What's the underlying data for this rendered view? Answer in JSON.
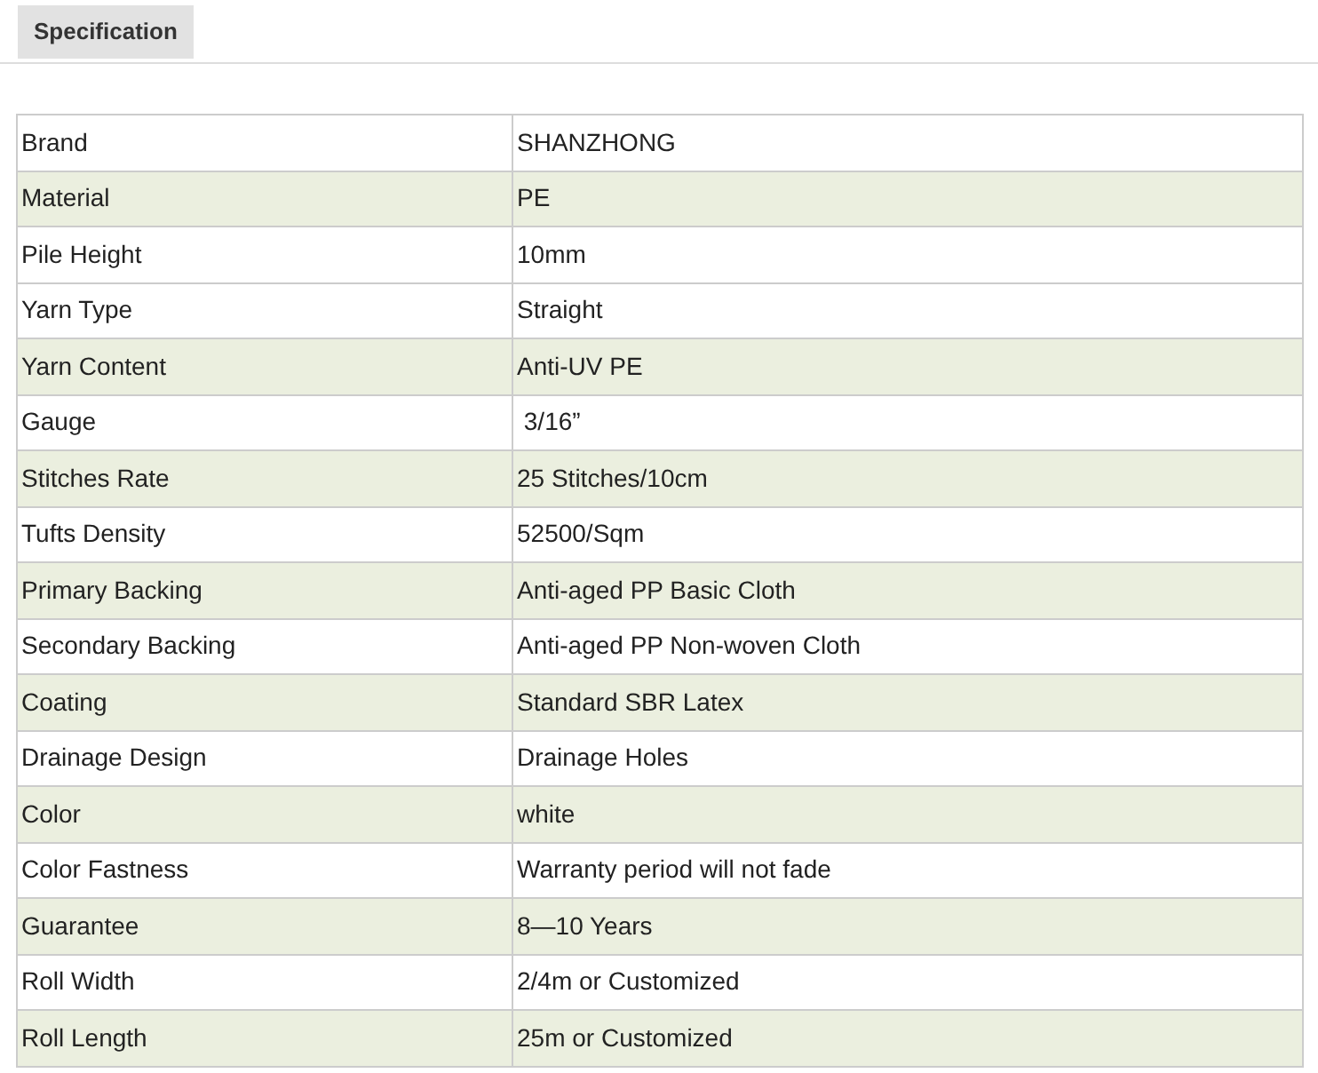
{
  "tabs": [
    {
      "label": "Specification",
      "selected": true
    }
  ],
  "table": {
    "rows": [
      {
        "label": "Brand",
        "value": "SHANZHONG",
        "shaded": false
      },
      {
        "label": "Material",
        "value": "PE",
        "shaded": true
      },
      {
        "label": "Pile Height",
        "value": "10mm",
        "shaded": false
      },
      {
        "label": "Yarn Type",
        "value": "Straight",
        "shaded": false
      },
      {
        "label": "Yarn Content",
        "value": "Anti-UV PE",
        "shaded": true
      },
      {
        "label": "Gauge",
        "value": " 3/16”",
        "shaded": false
      },
      {
        "label": "Stitches Rate",
        "value": "25 Stitches/10cm",
        "shaded": true
      },
      {
        "label": "Tufts Density",
        "value": "52500/Sqm",
        "shaded": false
      },
      {
        "label": "Primary Backing",
        "value": "Anti-aged PP Basic Cloth",
        "shaded": true
      },
      {
        "label": "Secondary Backing",
        "value": "Anti-aged PP Non-woven Cloth",
        "shaded": false
      },
      {
        "label": "Coating",
        "value": "Standard SBR Latex",
        "shaded": true
      },
      {
        "label": "Drainage Design",
        "value": "Drainage Holes",
        "shaded": false
      },
      {
        "label": "Color",
        "value": "white",
        "shaded": true
      },
      {
        "label": "Color Fastness",
        "value": "Warranty period will not fade",
        "shaded": false
      },
      {
        "label": "Guarantee",
        "value": "8—10 Years",
        "shaded": true
      },
      {
        "label": "Roll Width",
        "value": "2/4m or Customized",
        "shaded": false
      },
      {
        "label": "Roll Length",
        "value": "25m or Customized",
        "shaded": true
      }
    ]
  }
}
